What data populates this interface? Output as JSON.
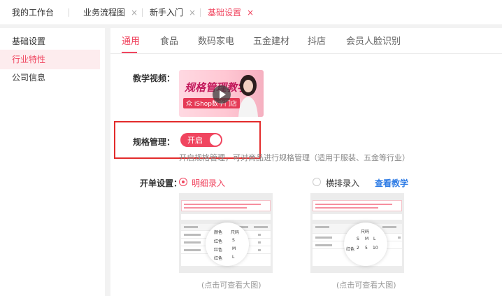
{
  "tabs": [
    {
      "label": "我的工作台",
      "closable": false,
      "active": false
    },
    {
      "label": "业务流程图",
      "closable": true,
      "active": false
    },
    {
      "label": "新手入门",
      "closable": true,
      "active": false
    },
    {
      "label": "基础设置",
      "closable": true,
      "active": true
    }
  ],
  "tab_close_glyph": "×",
  "sidebar": {
    "items": [
      {
        "label": "基础设置",
        "active": false
      },
      {
        "label": "行业特性",
        "active": true
      },
      {
        "label": "公司信息",
        "active": false
      }
    ]
  },
  "subtabs": [
    "通用",
    "食品",
    "数码家电",
    "五金建材",
    "抖店",
    "会员人脸识别"
  ],
  "active_subtab": "通用",
  "video": {
    "label": "教学视频：",
    "thumb_title": "规格管理教学",
    "thumb_sub": "众 iShop数字门店",
    "play_icon": "play-icon"
  },
  "spec": {
    "label": "规格管理：",
    "toggle_text": "开启",
    "enabled": true,
    "description": "开启规格管理，可对商品进行规格管理（适用于服装、五金等行业）"
  },
  "order": {
    "label": "开单设置：",
    "option_detail": "明细录入",
    "option_horizontal": "横排录入",
    "link": "查看教学",
    "selected": "明细录入",
    "caption": "(点击可查看大图)",
    "detail_zoom": {
      "header": [
        "颜色",
        "尺码"
      ],
      "rows": [
        [
          "红色",
          "S"
        ],
        [
          "红色",
          "M"
        ],
        [
          "红色",
          "L"
        ]
      ]
    },
    "horizontal_zoom": {
      "header": [
        "尺码"
      ],
      "sizes": [
        "S",
        "M",
        "L"
      ],
      "row": [
        "红色",
        "2",
        "5",
        "10"
      ]
    }
  },
  "colors": {
    "accent": "#f0455f",
    "link": "#2d7be5",
    "highlight": "#e32b2b"
  }
}
